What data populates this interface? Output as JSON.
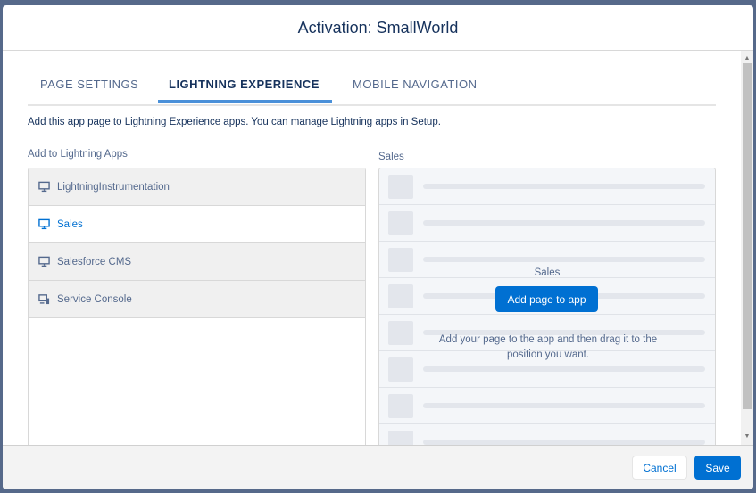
{
  "modal": {
    "title": "Activation: SmallWorld"
  },
  "tabs": [
    {
      "label": "PAGE SETTINGS"
    },
    {
      "label": "LIGHTNING EXPERIENCE",
      "active": true
    },
    {
      "label": "MOBILE NAVIGATION"
    }
  ],
  "description": "Add this app page to Lightning Experience apps. You can manage Lightning apps in Setup.",
  "apps_label": "Add to Lightning Apps",
  "apps": [
    {
      "label": "LightningInstrumentation",
      "icon": "desktop-icon"
    },
    {
      "label": "Sales",
      "icon": "desktop-icon",
      "selected": true
    },
    {
      "label": "Salesforce CMS",
      "icon": "desktop-icon"
    },
    {
      "label": "Service Console",
      "icon": "console-icon"
    }
  ],
  "preview": {
    "label": "Sales",
    "app_name": "Sales",
    "add_button": "Add page to app",
    "help": "Add your page to the app and then drag it to the position you want."
  },
  "footer": {
    "cancel": "Cancel",
    "save": "Save"
  },
  "colors": {
    "brand": "#0070d2",
    "title": "#16325c"
  }
}
